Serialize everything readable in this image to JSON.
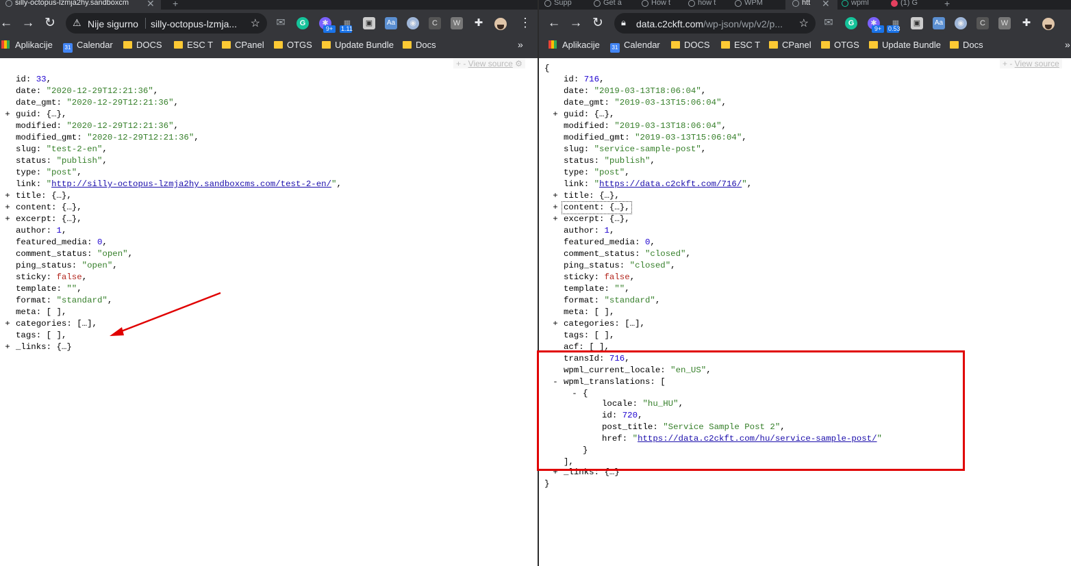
{
  "left": {
    "tabs": [
      {
        "label": "silly-octopus-lzmja2hy.sandboxcm"
      }
    ],
    "tab_close": "✕",
    "new_tab": "+",
    "security_label": "Nije sigurno",
    "url": "silly-octopus-lzmja...",
    "bookmarks": [
      "Aplikacije",
      "Calendar",
      "DOCS",
      "ESC T",
      "CPanel",
      "OTGS",
      "Update Bundle",
      "Docs"
    ],
    "bookmarks_more": "»",
    "ext_badges": [
      "9+",
      "1.11"
    ],
    "view_source": "View source",
    "json": {
      "id": "33",
      "date": "\"2020-12-29T12:21:36\"",
      "date_gmt": "\"2020-12-29T12:21:36\"",
      "guid": "{…}",
      "modified": "\"2020-12-29T12:21:36\"",
      "modified_gmt": "\"2020-12-29T12:21:36\"",
      "slug": "\"test-2-en\"",
      "status": "\"publish\"",
      "type": "\"post\"",
      "link": "http://silly-octopus-lzmja2hy.sandboxcms.com/test-2-en/",
      "title": "{…}",
      "content": "{…}",
      "excerpt": "{…}",
      "author": "1",
      "featured_media": "0",
      "comment_status": "\"open\"",
      "ping_status": "\"open\"",
      "sticky": "false",
      "template": "\"\"",
      "format": "\"standard\"",
      "meta": "[ ]",
      "categories": "[…]",
      "tags": "[ ]",
      "_links": "{…}"
    }
  },
  "right": {
    "tabs": [
      {
        "label": "Supp"
      },
      {
        "label": "Get a"
      },
      {
        "label": "How t"
      },
      {
        "label": "how t"
      },
      {
        "label": "WPM"
      },
      {
        "label": "htt"
      },
      {
        "label": "wpml"
      },
      {
        "label": "(1) G"
      }
    ],
    "tab_close": "✕",
    "new_tab": "+",
    "url_host": "data.c2ckft.com",
    "url_path": "/wp-json/wp/v2/p...",
    "bookmarks": [
      "Aplikacije",
      "Calendar",
      "DOCS",
      "ESC T",
      "CPanel",
      "OTGS",
      "Update Bundle",
      "Docs"
    ],
    "ext_badges": [
      "9+",
      "0.53"
    ],
    "view_source": "View source",
    "json": {
      "open_brace": "{",
      "id": "716",
      "date": "\"2019-03-13T18:06:04\"",
      "date_gmt": "\"2019-03-13T15:06:04\"",
      "guid": "{…}",
      "modified": "\"2019-03-13T18:06:04\"",
      "modified_gmt": "\"2019-03-13T15:06:04\"",
      "slug": "\"service-sample-post\"",
      "status": "\"publish\"",
      "type": "\"post\"",
      "link": "https://data.c2ckft.com/716/",
      "title": "{…}",
      "content": "{…}",
      "excerpt": "{…}",
      "author": "1",
      "featured_media": "0",
      "comment_status": "\"closed\"",
      "ping_status": "\"closed\"",
      "sticky": "false",
      "template": "\"\"",
      "format": "\"standard\"",
      "meta": "[ ]",
      "categories": "[…]",
      "tags": "[ ]",
      "acf": "[ ]",
      "transId": "716",
      "wpml_current_locale": "\"en_US\"",
      "wpml_translations_open": "[",
      "item_open": "{",
      "locale": "\"hu_HU\"",
      "item_id": "720",
      "post_title": "\"Service Sample Post 2\"",
      "href": "https://data.c2ckft.com/hu/service-sample-post/",
      "item_close": "}",
      "translations_close": "],",
      "_links": "{…}",
      "close_brace": "}"
    }
  },
  "colors": {
    "annotation_red": "#e00000",
    "string_green": "#357f29",
    "number_blue": "#1c00cf",
    "bool_red": "#b3261e",
    "link_blue": "#1a0dab",
    "chrome_dark": "#35363a"
  }
}
